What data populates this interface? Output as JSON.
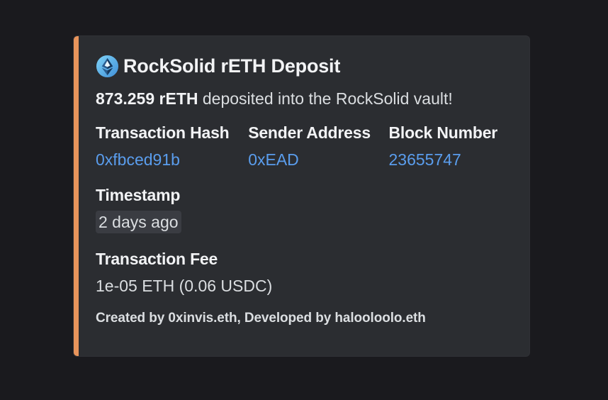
{
  "embed": {
    "accent_color": "#e8945b",
    "icon": "ethereum-diamond-icon",
    "title": "RockSolid rETH Deposit",
    "description_amount": "873.259 rETH",
    "description_text": " deposited into the RockSolid vault!",
    "fields": [
      {
        "name": "Transaction Hash",
        "value": "0xfbced91b"
      },
      {
        "name": "Sender Address",
        "value": "0xEAD"
      },
      {
        "name": "Block Number",
        "value": "23655747"
      }
    ],
    "timestamp": {
      "name": "Timestamp",
      "value": "2 days ago"
    },
    "fee": {
      "name": "Transaction Fee",
      "value": "1e-05 ETH (0.06 USDC)"
    },
    "footer": "Created by 0xinvis.eth, Developed by halooloolo.eth"
  }
}
